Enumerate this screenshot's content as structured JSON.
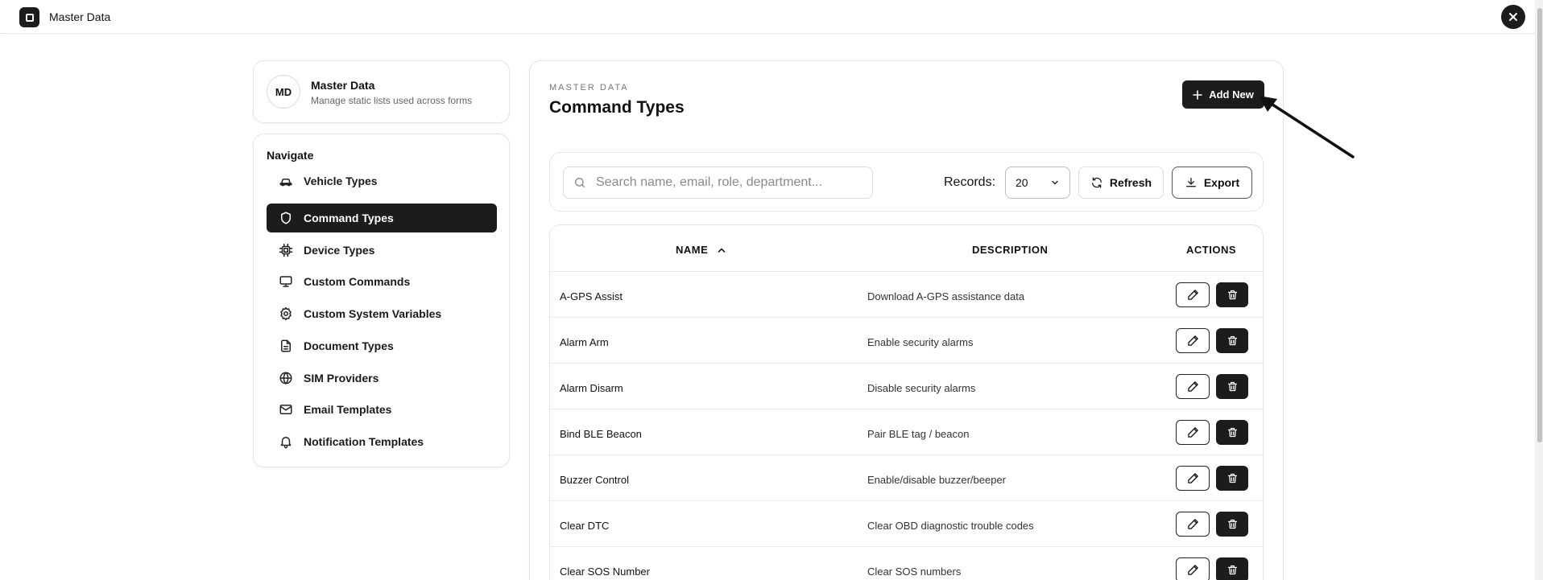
{
  "app": {
    "title": "Master Data"
  },
  "profile": {
    "initials": "MD",
    "title": "Master Data",
    "subtitle": "Manage static lists used across forms"
  },
  "nav": {
    "heading": "Navigate",
    "items": [
      {
        "label": "Vehicle Types",
        "icon": "car-icon",
        "active": false
      },
      {
        "label": "Command Types",
        "icon": "shield-icon",
        "active": true
      },
      {
        "label": "Device Types",
        "icon": "chip-icon",
        "active": false
      },
      {
        "label": "Custom Commands",
        "icon": "monitor-icon",
        "active": false
      },
      {
        "label": "Custom System Variables",
        "icon": "gear-icon",
        "active": false
      },
      {
        "label": "Document Types",
        "icon": "document-icon",
        "active": false
      },
      {
        "label": "SIM Providers",
        "icon": "globe-icon",
        "active": false
      },
      {
        "label": "Email Templates",
        "icon": "mail-icon",
        "active": false
      },
      {
        "label": "Notification Templates",
        "icon": "bell-icon",
        "active": false
      }
    ]
  },
  "main": {
    "eyebrow": "MASTER DATA",
    "title": "Command Types",
    "add_label": "Add New",
    "search": {
      "placeholder": "Search name, email, role, department..."
    },
    "records_label": "Records:",
    "records_value": "20",
    "refresh_label": "Refresh",
    "export_label": "Export",
    "table": {
      "columns": {
        "name": "NAME",
        "description": "DESCRIPTION",
        "actions": "ACTIONS"
      },
      "rows": [
        {
          "name": "A-GPS Assist",
          "description": "Download A-GPS assistance data"
        },
        {
          "name": "Alarm Arm",
          "description": "Enable security alarms"
        },
        {
          "name": "Alarm Disarm",
          "description": "Disable security alarms"
        },
        {
          "name": "Bind BLE Beacon",
          "description": "Pair BLE tag / beacon"
        },
        {
          "name": "Buzzer Control",
          "description": "Enable/disable buzzer/beeper"
        },
        {
          "name": "Clear DTC",
          "description": "Clear OBD diagnostic trouble codes"
        },
        {
          "name": "Clear SOS Number",
          "description": "Clear SOS numbers"
        }
      ]
    }
  }
}
